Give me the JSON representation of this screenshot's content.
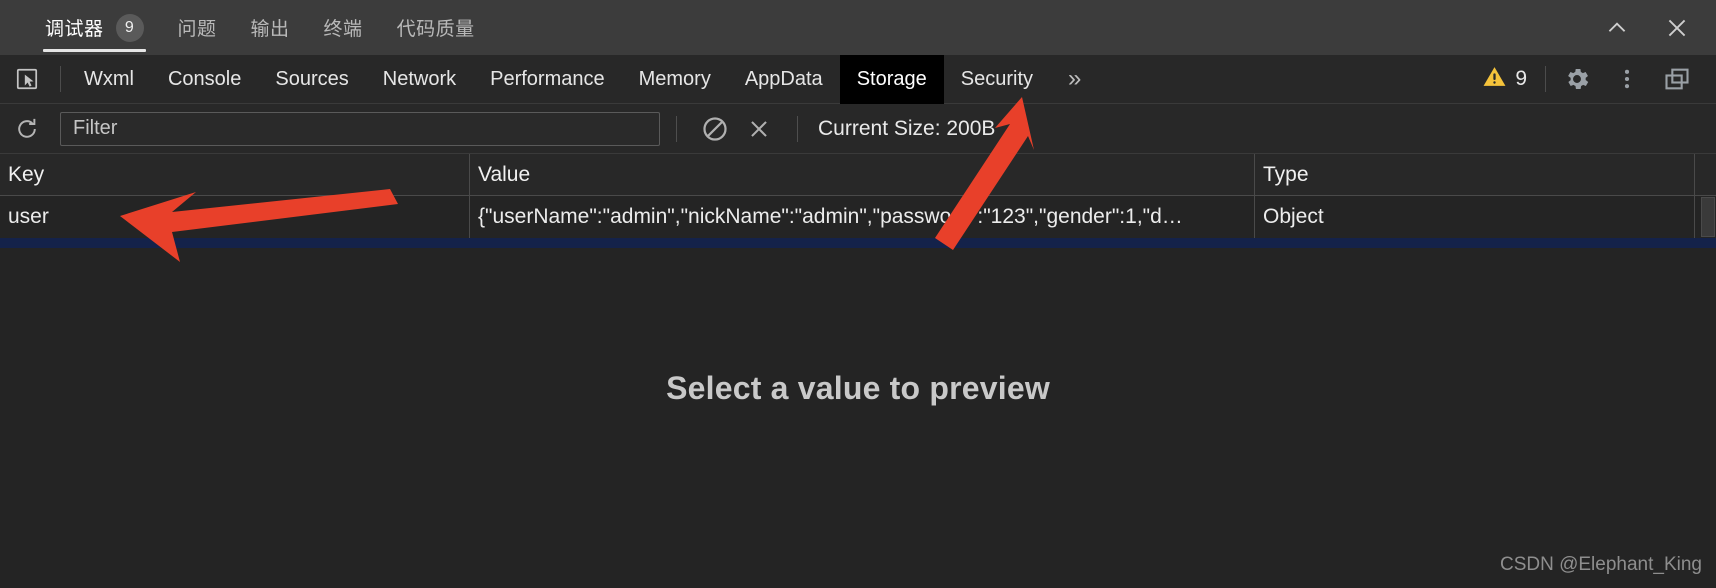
{
  "ide": {
    "tabs": [
      {
        "label": "调试器",
        "badge": "9",
        "active": true
      },
      {
        "label": "问题",
        "badge": "",
        "active": false
      },
      {
        "label": "输出",
        "badge": "",
        "active": false
      },
      {
        "label": "终端",
        "badge": "",
        "active": false
      },
      {
        "label": "代码质量",
        "badge": "",
        "active": false
      }
    ],
    "collapse_icon": "chevron-up-icon",
    "close_icon": "close-icon"
  },
  "devtools": {
    "inspect_icon": "inspect-cursor-icon",
    "tabs": [
      {
        "label": "Wxml",
        "selected": false
      },
      {
        "label": "Console",
        "selected": false
      },
      {
        "label": "Sources",
        "selected": false
      },
      {
        "label": "Network",
        "selected": false
      },
      {
        "label": "Performance",
        "selected": false
      },
      {
        "label": "Memory",
        "selected": false
      },
      {
        "label": "AppData",
        "selected": false
      },
      {
        "label": "Storage",
        "selected": true
      },
      {
        "label": "Security",
        "selected": false
      }
    ],
    "more_tabs_label": "»",
    "warning_count": "9",
    "warning_icon": "warning-triangle-icon",
    "settings_icon": "gear-icon",
    "menu_icon": "vertical-dots-icon",
    "dock_icon": "dock-window-icon"
  },
  "toolbar": {
    "refresh_icon": "refresh-icon",
    "filter_placeholder": "Filter",
    "filter_value": "",
    "clear_all_icon": "no-entry-icon",
    "delete_icon": "close-x-icon",
    "current_size_label": "Current Size: 200B"
  },
  "grid": {
    "columns": [
      "Key",
      "Value",
      "Type"
    ],
    "rows": [
      {
        "key": "user",
        "value": "{\"userName\":\"admin\",\"nickName\":\"admin\",\"password\":\"123\",\"gender\":1,\"d…",
        "type": "Object"
      }
    ]
  },
  "preview": {
    "empty_message": "Select a value to preview"
  },
  "watermark": {
    "text": "CSDN @Elephant_King"
  },
  "colors": {
    "accent_selection": "#14224a",
    "annotation_red": "#e8402a",
    "warning_yellow": "#f5c33b",
    "panel_bg": "#242424",
    "toolbar_bg": "#282828",
    "ide_bg": "#3c3c3c"
  }
}
